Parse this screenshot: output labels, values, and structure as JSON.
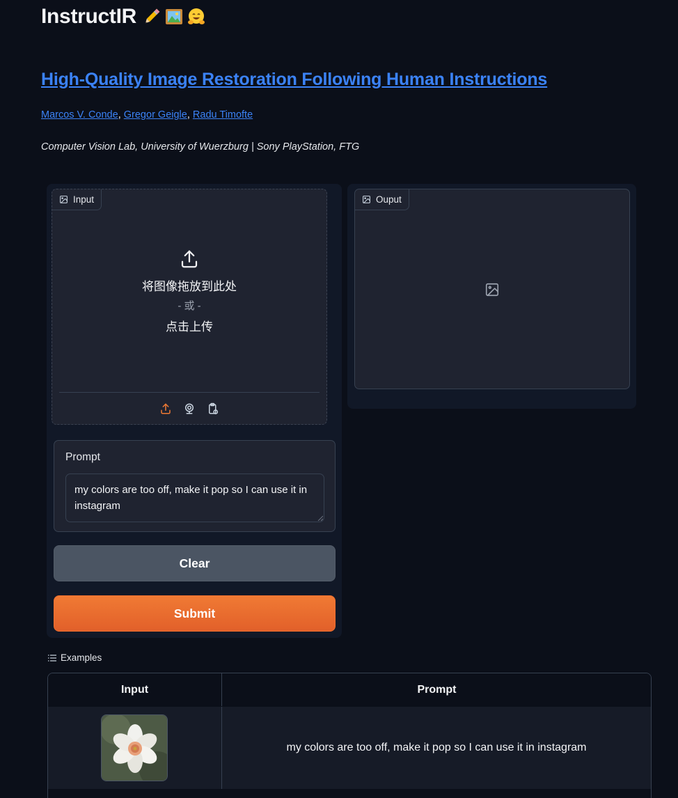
{
  "header": {
    "title": "InstructIR",
    "title_emojis": [
      "pencil-emoji",
      "framed-picture-emoji",
      "hugging-face-emoji"
    ],
    "subtitle_link": "High-Quality Image Restoration Following Human Instructions",
    "authors": [
      "Marcos V. Conde",
      "Gregor Geigle",
      "Radu Timofte"
    ],
    "author_separator": ", ",
    "affiliation": "Computer Vision Lab, University of Wuerzburg | Sony PlayStation, FTG"
  },
  "input_image": {
    "label": "Input",
    "drop_text": "将图像拖放到此处",
    "or_text": "- 或 -",
    "click_text": "点击上传",
    "sources": [
      "upload-icon",
      "webcam-icon",
      "clipboard-icon"
    ]
  },
  "output_image": {
    "label": "Ouput"
  },
  "prompt": {
    "label": "Prompt",
    "value": "my colors are too off, make it pop so I can use it in instagram"
  },
  "buttons": {
    "clear": "Clear",
    "submit": "Submit"
  },
  "examples": {
    "label": "Examples",
    "columns": [
      "Input",
      "Prompt"
    ],
    "rows": [
      {
        "input_thumbnail": "flower-photo",
        "prompt": "my colors are too off, make it pop so I can use it in instagram"
      }
    ]
  },
  "colors": {
    "background": "#0b0f19",
    "panel": "#111827",
    "block": "#1f2330",
    "border": "#374151",
    "link": "#3b82f6",
    "accent_orange": "#ef6f2e",
    "clear_button": "#4b5563"
  }
}
